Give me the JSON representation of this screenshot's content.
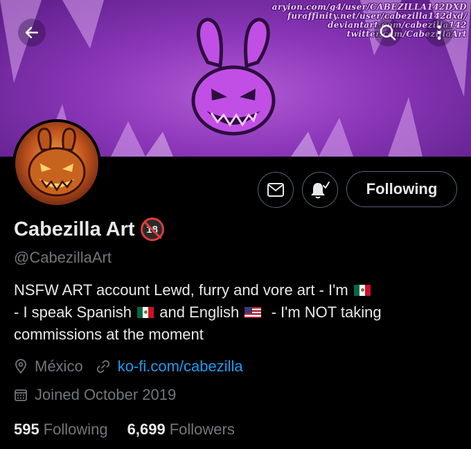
{
  "banner": {
    "watermark_lines": [
      "aryion.com/g4/user/CABEZILLA142DXD",
      "furaffinity.net/user/cabezilla142dxd/",
      "deviantart.com/cabezilla142",
      "twitter.com/CabezillaArt"
    ]
  },
  "header": {
    "back_icon": "arrow-left-icon",
    "search_icon": "search-icon",
    "more_icon": "more-vertical-icon"
  },
  "actions": {
    "message_icon": "envelope-icon",
    "notify_icon": "bell-check-icon",
    "following_label": "Following"
  },
  "profile": {
    "display_name": "Cabezilla Art",
    "age_badge": "18",
    "handle": "@CabezillaArt",
    "bio": {
      "line1_text": "NSFW ART account Lewd, furry and vore art - I'm",
      "line2_a": "- I speak Spanish",
      "line2_b": "and English",
      "line2_c": "- I'm NOT taking",
      "line3": "commissions at the moment"
    },
    "location": "México",
    "website": "ko-fi.com/cabezilla",
    "joined": "Joined October 2019"
  },
  "stats": {
    "following_count": "595",
    "following_label": "Following",
    "followers_count": "6,699",
    "followers_label": "Followers"
  },
  "colors": {
    "accent": "#1d9bf0",
    "muted": "#71767b",
    "text": "#e7e9ea",
    "banner_purple": "#8a36b8"
  }
}
